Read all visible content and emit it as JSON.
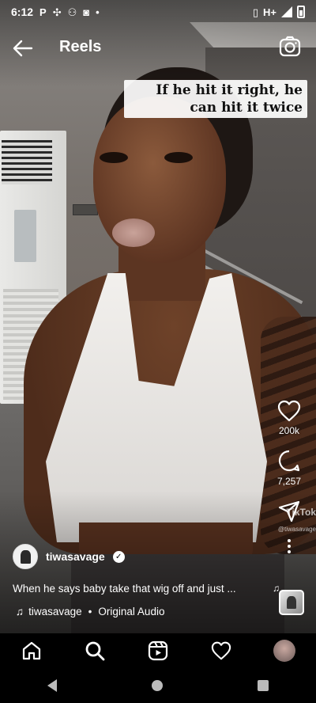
{
  "status_bar": {
    "time": "6:12",
    "left_icons": [
      "p-icon",
      "pinwheel-icon",
      "vpn-icon",
      "instagram-icon",
      "dot-icon"
    ],
    "network": "H+"
  },
  "header": {
    "title": "Reels"
  },
  "video": {
    "overlay_text": "If he hit it right, he can hit it twice",
    "watermark": "TikTok",
    "watermark_user": "@tiwasavage"
  },
  "actions": {
    "like_count": "200k",
    "comment_count": "7,257"
  },
  "post": {
    "author": "tiwasavage",
    "caption": "When he says baby take that wig off and just ...",
    "audio_author": "tiwasavage",
    "audio_separator": "•",
    "audio_title": "Original Audio"
  },
  "icons": {
    "back": "arrow-left-icon",
    "camera": "camera-icon",
    "like": "heart-icon",
    "comment": "comment-icon",
    "share": "send-icon",
    "more": "more-vertical-icon",
    "music": "music-note-icon",
    "home": "home-icon",
    "search": "search-icon",
    "reels": "reels-icon",
    "activity": "heart-icon",
    "profile": "profile-avatar"
  },
  "colors": {
    "background": "#000000",
    "text": "#ffffff",
    "overlay_caption_bg": "#f2f0ed"
  }
}
